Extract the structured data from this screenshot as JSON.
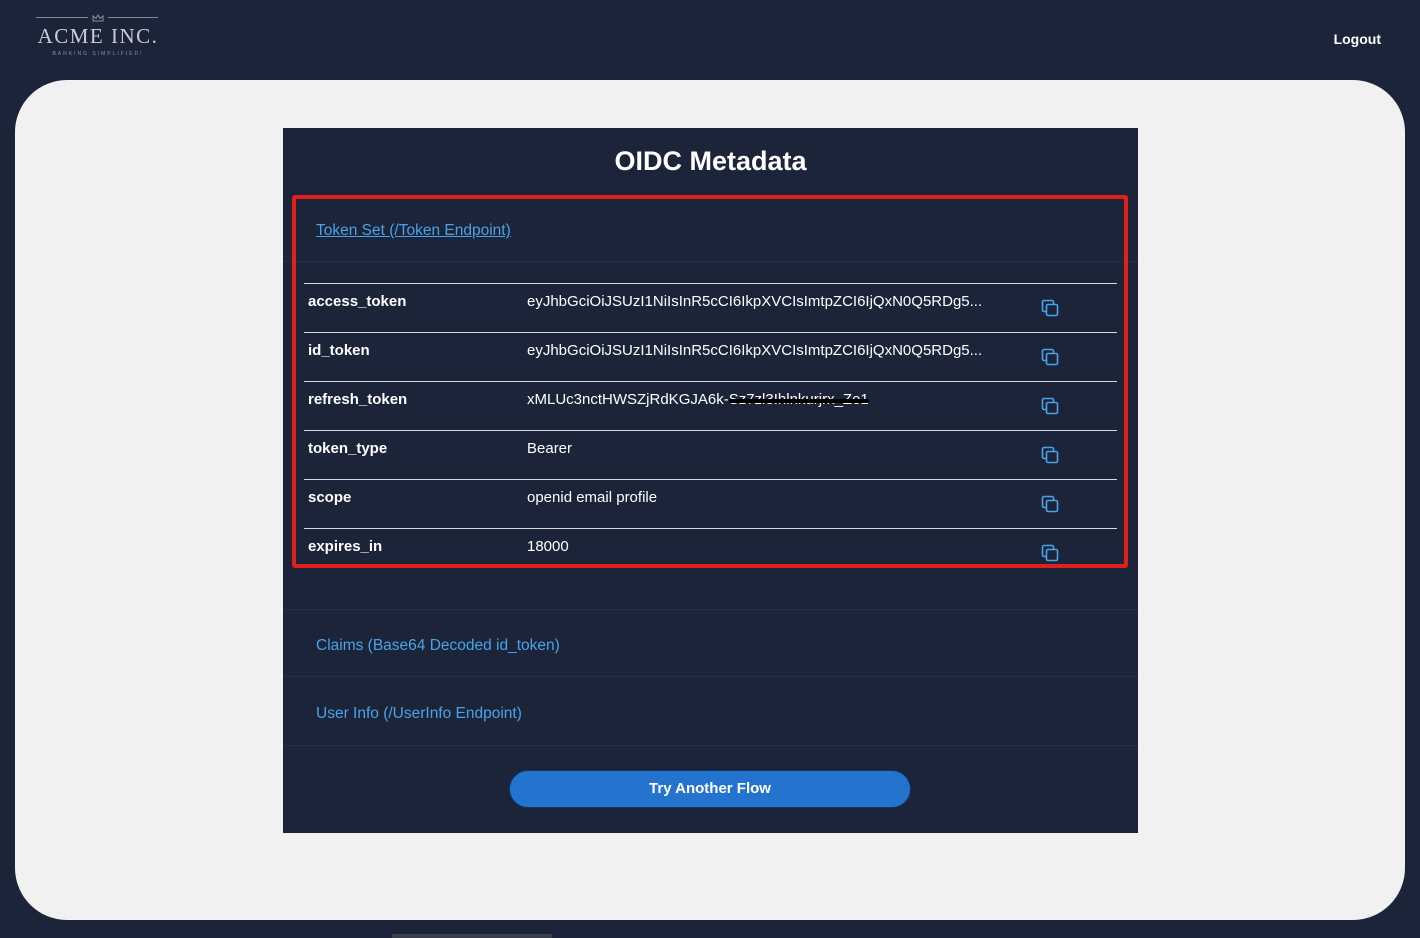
{
  "header": {
    "logo_name": "ACME INC.",
    "logo_tagline": "BANKING SIMPLIFIED!",
    "logout_label": "Logout"
  },
  "card": {
    "title": "OIDC Metadata",
    "token_section_label": "Token Set (/Token Endpoint)",
    "claims_section_label": "Claims (Base64 Decoded id_token)",
    "userinfo_section_label": "User Info (/UserInfo Endpoint)",
    "button_label": "Try Another Flow"
  },
  "tokens": [
    {
      "key": "access_token",
      "value": "eyJhbGciOiJSUzI1NiIsInR5cCI6IkpXVCIsImtpZCI6IjQxN0Q5RDg5..."
    },
    {
      "key": "id_token",
      "value": "eyJhbGciOiJSUzI1NiIsInR5cCI6IkpXVCIsImtpZCI6IjQxN0Q5RDg5..."
    },
    {
      "key": "refresh_token",
      "value": "xMLUc3nctHWSZjRdKGJA6k-",
      "value_redacted": "Sz7zl3Ihlnkurjrx_Ze1"
    },
    {
      "key": "token_type",
      "value": "Bearer"
    },
    {
      "key": "scope",
      "value": "openid email profile"
    },
    {
      "key": "expires_in",
      "value": "18000"
    }
  ],
  "colors": {
    "page_bg": "#1b2438",
    "panel_bg": "#f1f1f1",
    "link": "#4aa3e8",
    "highlight_border": "#e0201f",
    "button_bg": "#2474cf"
  },
  "icons": {
    "copy": "copy-icon",
    "logo_crown": "crown-icon"
  }
}
